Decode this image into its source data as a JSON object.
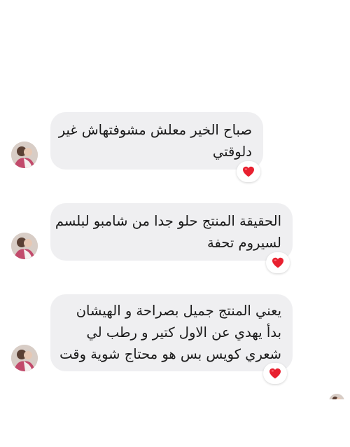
{
  "messages": [
    {
      "lines": [
        "صباح الخير معلش مشوفتهاش غير",
        "دلوقتي"
      ],
      "reaction": "heart-reaction"
    },
    {
      "lines": [
        "الحقيقة المنتج حلو جدا من شامبو لبلسم",
        "لسيروم تحفة"
      ],
      "reaction": "heart-reaction"
    },
    {
      "lines": [
        "يعني المنتج جميل بصراحة و الهيشان",
        "بدأ يهدي عن الاول كتير و رطب لي",
        "شعري كويس بس هو محتاج شوية وقت"
      ],
      "reaction": "heart-reaction"
    }
  ],
  "colors": {
    "bubble": "#efeff1",
    "heart": "#e8202f",
    "background": "#ffffff"
  },
  "icons": {
    "avatar": "user-avatar",
    "reaction": "red-heart-emoji"
  }
}
